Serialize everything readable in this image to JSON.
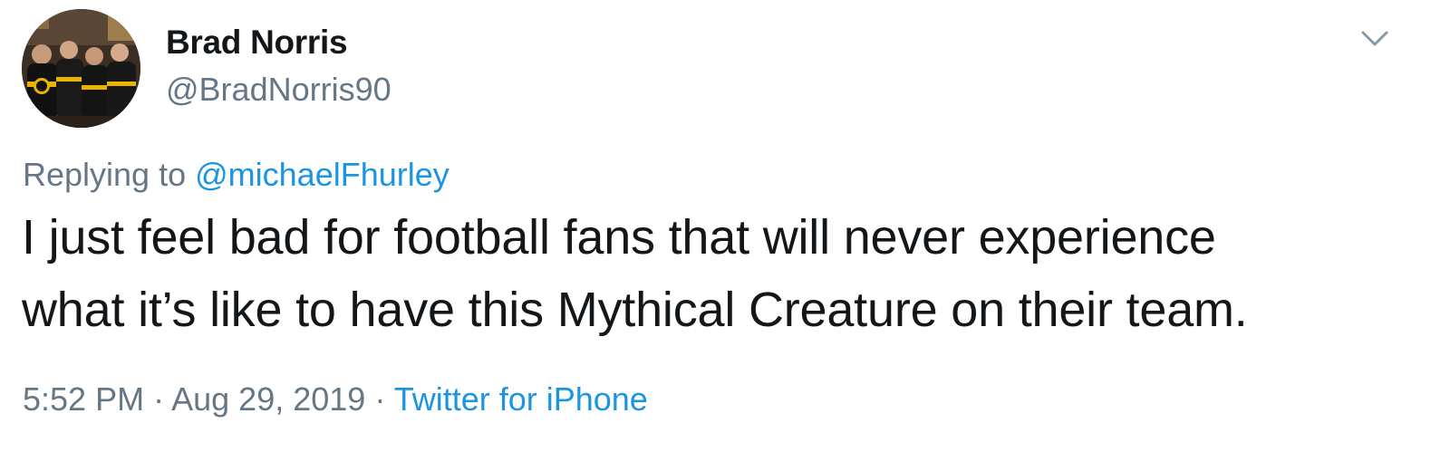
{
  "author": {
    "name": "Brad Norris",
    "handle": "@BradNorris90"
  },
  "reply": {
    "prefix": "Replying to",
    "mention": "@michaelFhurley"
  },
  "tweet": {
    "line1": "I just feel bad for football fans that will never experience",
    "line2": "what it’s like to have this Mythical Creature on their team."
  },
  "meta": {
    "time": "5:52 PM",
    "separator": "·",
    "date": "Aug 29, 2019",
    "source": "Twitter for iPhone"
  },
  "icons": {
    "menu": "chevron-down-icon",
    "avatar": "avatar"
  },
  "colors": {
    "text": "#14171a",
    "secondary": "#657786",
    "link": "#1b95e0"
  }
}
